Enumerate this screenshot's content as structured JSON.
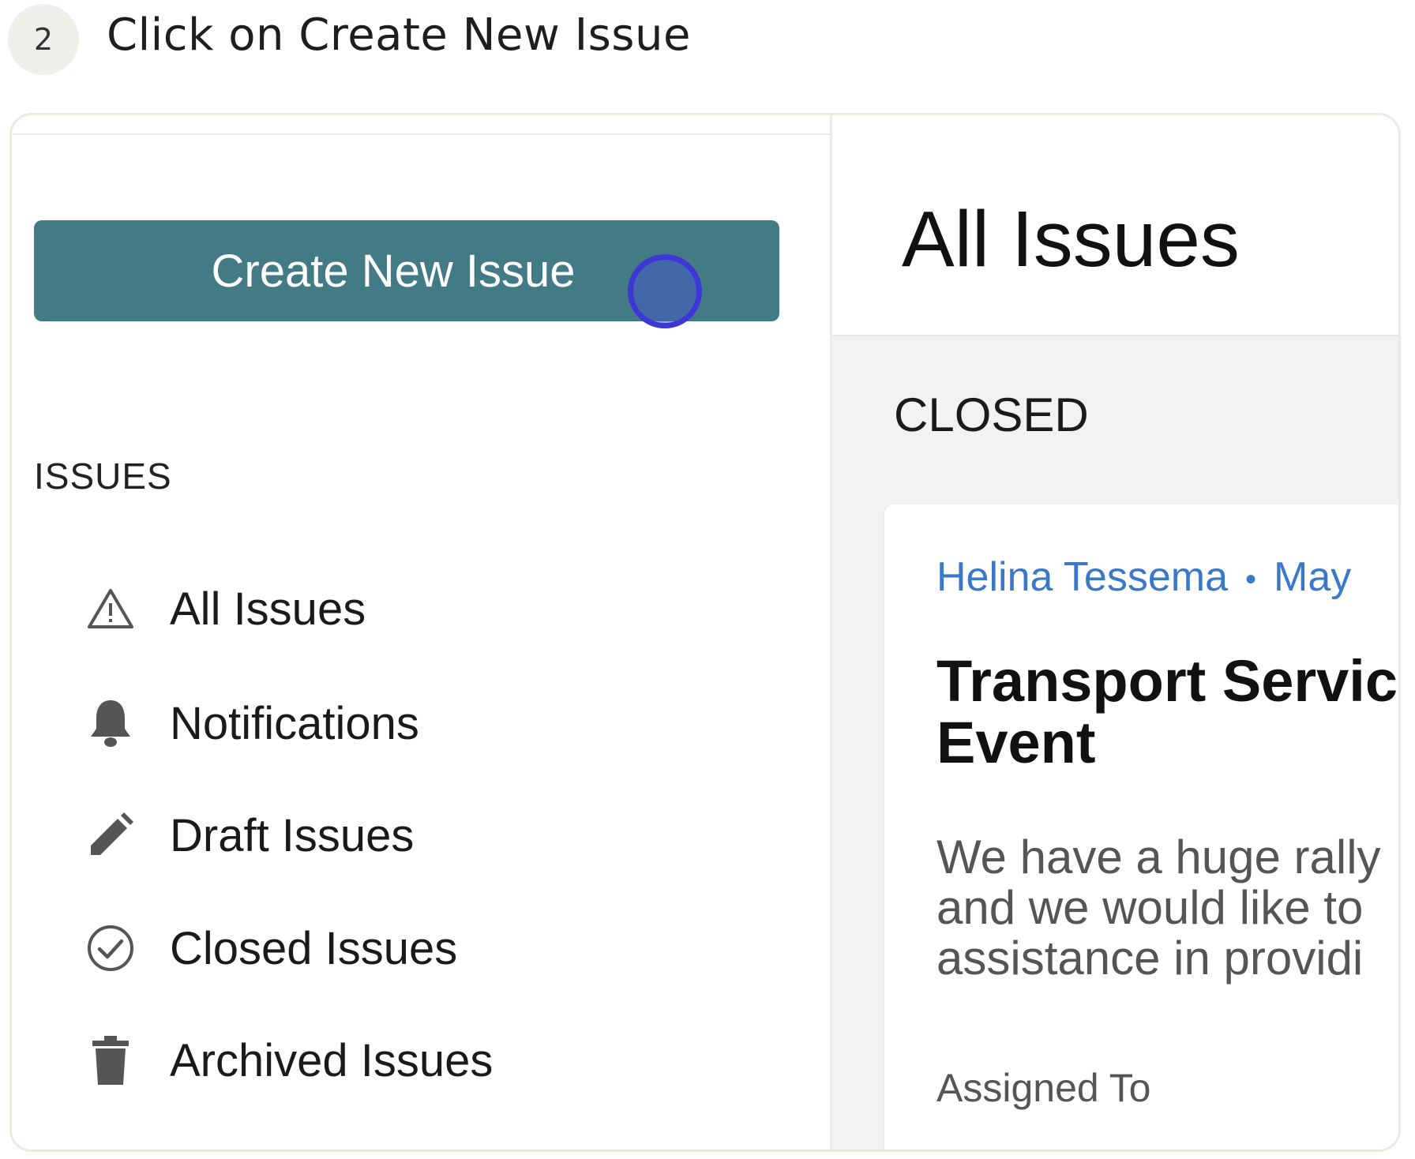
{
  "step": {
    "number": "2",
    "instruction": "Click on Create New Issue"
  },
  "sidebar": {
    "create_button_label": "Create New Issue",
    "section_label": "ISSUES",
    "items": [
      {
        "label": "All Issues",
        "icon": "warning-triangle-icon"
      },
      {
        "label": "Notifications",
        "icon": "bell-icon"
      },
      {
        "label": "Draft Issues",
        "icon": "pencil-icon"
      },
      {
        "label": "Closed Issues",
        "icon": "check-circle-icon"
      },
      {
        "label": "Archived Issues",
        "icon": "trash-icon"
      }
    ]
  },
  "main": {
    "title": "All Issues",
    "status_heading": "CLOSED",
    "card": {
      "author": "Helina Tessema",
      "date": "May",
      "title_line1": "Transport Servic",
      "title_line2": "Event",
      "description_lines": [
        "We have a huge rally",
        "and we would like to",
        "assistance in providi"
      ],
      "assigned_label": "Assigned To"
    }
  },
  "colors": {
    "primary_button": "#427a85",
    "link_blue": "#3a78c8",
    "click_marker": "#3e37d6"
  }
}
